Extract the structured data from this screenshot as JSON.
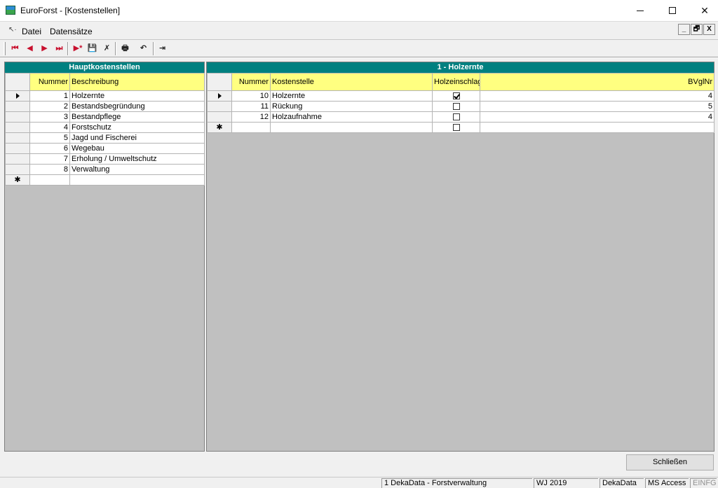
{
  "window": {
    "title": "EuroForst - [Kostenstellen]",
    "min_glyph": "",
    "max_glyph": "",
    "close_glyph": "✕"
  },
  "menu": {
    "items": [
      "Datei",
      "Datensätze"
    ],
    "mdi_buttons": [
      "_",
      "🗗",
      "X"
    ]
  },
  "toolbar": {
    "first": "⏮",
    "prev": "◀",
    "next": "▶",
    "last": "⏭",
    "new": "▶*",
    "save": "💾",
    "delete": "✗",
    "print": "🖶",
    "undo": "↶",
    "exit": "⇥"
  },
  "left_panel": {
    "title": "Hauptkostenstellen",
    "columns": [
      "Nummer",
      "Beschreibung"
    ],
    "rows": [
      {
        "nummer": "1",
        "beschreibung": "Holzernte"
      },
      {
        "nummer": "2",
        "beschreibung": "Bestandsbegründung"
      },
      {
        "nummer": "3",
        "beschreibung": "Bestandpflege"
      },
      {
        "nummer": "4",
        "beschreibung": "Forstschutz"
      },
      {
        "nummer": "5",
        "beschreibung": "Jagd und Fischerei"
      },
      {
        "nummer": "6",
        "beschreibung": "Wegebau"
      },
      {
        "nummer": "7",
        "beschreibung": "Erholung / Umweltschutz"
      },
      {
        "nummer": "8",
        "beschreibung": "Verwaltung"
      }
    ],
    "new_row_marker": "✱"
  },
  "right_panel": {
    "title": "1 - Holzernte",
    "columns": [
      "Nummer",
      "Kostenstelle",
      "Holzeinschlag",
      "BVglNr"
    ],
    "rows": [
      {
        "nummer": "10",
        "kostenstelle": "Holzernte",
        "holzeinschlag": true,
        "bvglnr": "4"
      },
      {
        "nummer": "11",
        "kostenstelle": "Rückung",
        "holzeinschlag": false,
        "bvglnr": "5"
      },
      {
        "nummer": "12",
        "kostenstelle": "Holzaufnahme",
        "holzeinschlag": false,
        "bvglnr": "4"
      }
    ],
    "new_row_marker": "✱"
  },
  "buttons": {
    "close_label": "Schließen"
  },
  "statusbar": {
    "company": "1 DekaData - Forstverwaltung",
    "year": "WJ 2019",
    "user": "DekaData",
    "database": "MS Access",
    "insert_mode": "EINFG"
  }
}
